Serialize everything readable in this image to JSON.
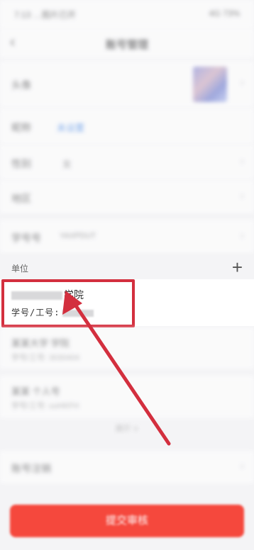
{
  "status_bar": {
    "left_text": "7:13 …图片已开",
    "right_text": "4G 73%"
  },
  "nav": {
    "back_icon": "‹",
    "title": "账号管理"
  },
  "rows": [
    {
      "label": "头像",
      "value": ""
    },
    {
      "label": "昵称",
      "value": "未设置"
    },
    {
      "label": "性别",
      "value": "女"
    },
    {
      "label": "地区",
      "value": ""
    },
    {
      "label": "学号号",
      "value": "YAXPDUT"
    }
  ],
  "section": {
    "label": "单位",
    "add_icon": "+"
  },
  "unit": {
    "name_suffix": "学院",
    "id_label": "学号/工号:"
  },
  "list": [
    {
      "title": "某某大学 学院",
      "sub": "学号/工号: 3030404"
    },
    {
      "title": "某某 个人号",
      "sub": "学号/工号: uuHKFH"
    }
  ],
  "more_text": "展开 ∨",
  "bottom_row": {
    "label": "账号注销"
  },
  "submit": {
    "label": "提交审核"
  },
  "colors": {
    "accent": "#f5483d",
    "highlight": "#d32f3e",
    "link": "#2b78e4"
  }
}
